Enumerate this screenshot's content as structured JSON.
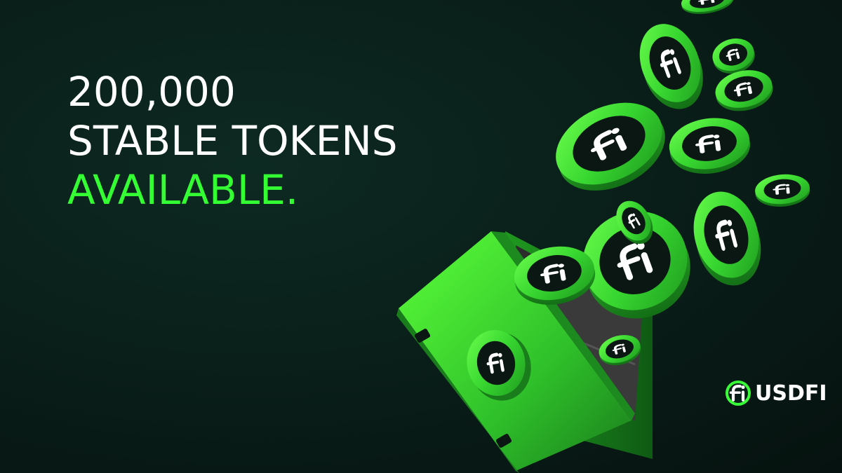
{
  "headline": {
    "line1": "200,000",
    "line2": "STABLE TOKENS",
    "line3": "AVAILABLE."
  },
  "brand": {
    "name": "USDFI",
    "logo_icon": "fi-logo-icon"
  },
  "colors": {
    "background": "#0a1f1a",
    "accent_green": "#33ff33",
    "coin_green": "#35d42f",
    "coin_dark": "#0b1712",
    "text_white": "#ffffff"
  },
  "icons": [
    "fi-coin-icon",
    "vault-safe-icon",
    "fi-logo-icon"
  ]
}
